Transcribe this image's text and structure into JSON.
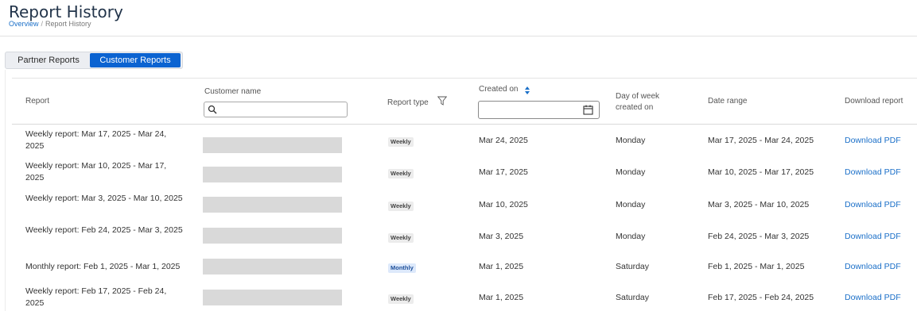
{
  "page": {
    "title": "Report History",
    "breadcrumb": [
      {
        "label": "Overview"
      },
      {
        "label": "Report History"
      }
    ]
  },
  "tabs": [
    {
      "label": "Partner Reports",
      "active": false
    },
    {
      "label": "Customer Reports",
      "active": true
    }
  ],
  "colors": {
    "accent": "#0b63d1",
    "link": "#1a6fc8"
  },
  "table": {
    "columns": {
      "report": "Report",
      "customer_name": "Customer name",
      "report_type": "Report type",
      "created_on": "Created on",
      "day_of_week": "Day of week created on",
      "date_range": "Date range",
      "download": "Download report"
    },
    "customer_search": {
      "value": "",
      "placeholder": ""
    },
    "created_on_filter": {
      "value": "",
      "placeholder": ""
    },
    "rows": [
      {
        "report": "Weekly report: Mar 17, 2025 - Mar 24, 2025",
        "customer": "redacted",
        "type": "Weekly",
        "created_on": "Mar 24, 2025",
        "day": "Monday",
        "range": "Mar 17, 2025 - Mar 24, 2025",
        "download": "Download PDF"
      },
      {
        "report": "Weekly report: Mar 10, 2025 - Mar 17, 2025",
        "customer": "redacted",
        "type": "Weekly",
        "created_on": "Mar 17, 2025",
        "day": "Monday",
        "range": "Mar 10, 2025 - Mar 17, 2025",
        "download": "Download PDF"
      },
      {
        "report": "Weekly report: Mar 3, 2025 - Mar 10, 2025",
        "customer": "redacted",
        "type": "Weekly",
        "created_on": "Mar 10, 2025",
        "day": "Monday",
        "range": "Mar 3, 2025 - Mar 10, 2025",
        "download": "Download PDF"
      },
      {
        "report": "Weekly report: Feb 24, 2025 - Mar 3, 2025",
        "customer": "redacted",
        "type": "Weekly",
        "created_on": "Mar 3, 2025",
        "day": "Monday",
        "range": "Feb 24, 2025 - Mar 3, 2025",
        "download": "Download PDF"
      },
      {
        "report": "Monthly report: Feb 1, 2025 - Mar 1, 2025",
        "customer": "redacted",
        "type": "Monthly",
        "created_on": "Mar 1, 2025",
        "day": "Saturday",
        "range": "Feb 1, 2025 - Mar 1, 2025",
        "download": "Download PDF"
      },
      {
        "report": "Weekly report: Feb 17, 2025 - Feb 24, 2025",
        "customer": "redacted",
        "type": "Weekly",
        "created_on": "Mar 1, 2025",
        "day": "Saturday",
        "range": "Feb 17, 2025 - Feb 24, 2025",
        "download": "Download PDF"
      }
    ]
  }
}
